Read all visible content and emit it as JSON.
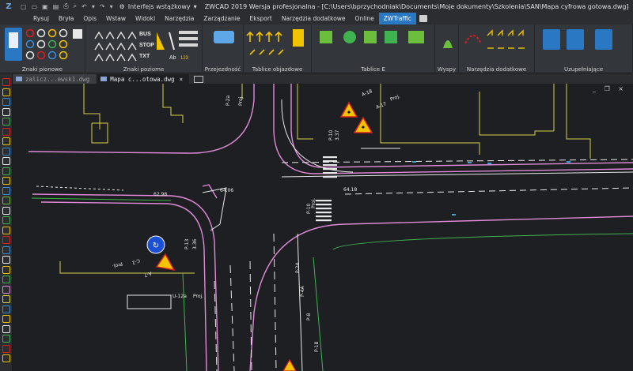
{
  "titlebar": {
    "workspace": "Interfejs wstążkowy",
    "title": "ZWCAD 2019 Wersja profesjonalna - [C:\\Users\\bprzychodniak\\Documents\\Moje dokumenty\\Szkolenia\\SAN\\Mapa cyfrowa gotowa.dwg]"
  },
  "menu": [
    "Rysuj",
    "Bryła",
    "Opis",
    "Wstaw",
    "Widoki",
    "Narzędzia",
    "Zarządzanie",
    "Eksport",
    "Narzędzia dodatkowe",
    "Online",
    "ZWTraffic"
  ],
  "menu_active_index": 10,
  "ribbon_groups": [
    "Znaki pionowe",
    "Znaki poziome",
    "Przejezdność",
    "Tablice objazdowe",
    "Tablice E",
    "Wyspy",
    "Narzędzia dodatkowe",
    "Uzupełniające"
  ],
  "ribbon_icon_text": {
    "bus": "BUS",
    "stop": "STOP",
    "txt": "TXT",
    "ab": "Ab",
    "num": "123"
  },
  "tabs": [
    {
      "label": "zalicz...ewsk1.dwg",
      "close": ""
    },
    {
      "label": "Mapa c...otowa.dwg",
      "close": "×"
    }
  ],
  "window_controls": "_ ❐ ×",
  "drawing_labels": {
    "a18": "A-18",
    "a17": "A-17",
    "proj1": "Proj.",
    "p10": "P-10",
    "p37": "3.37",
    "p2a": "P-2a",
    "proj2": "Proj.",
    "d1": "62.98",
    "d2": "64.06",
    "d3": "64.18",
    "p10b": "P-10",
    "proj3": "Proj.",
    "c2": "C-2",
    "a7": "A-7",
    "proj4": "Proj.",
    "p13": "P-13",
    "u12a": "U-12a",
    "proj5": "Proj.",
    "p24": "P-24",
    "p8": "P-8",
    "p4a": "P-4A",
    "p18": "P-18",
    "val1": "3.36"
  },
  "colors": {
    "accent": "#2a78c4",
    "road": "#e08ad8",
    "building": "#d6d04a",
    "lane": "#e8e8e8",
    "green": "#3fb34f",
    "sign_yellow": "#f2c400",
    "sign_blue": "#1a4fd6"
  }
}
